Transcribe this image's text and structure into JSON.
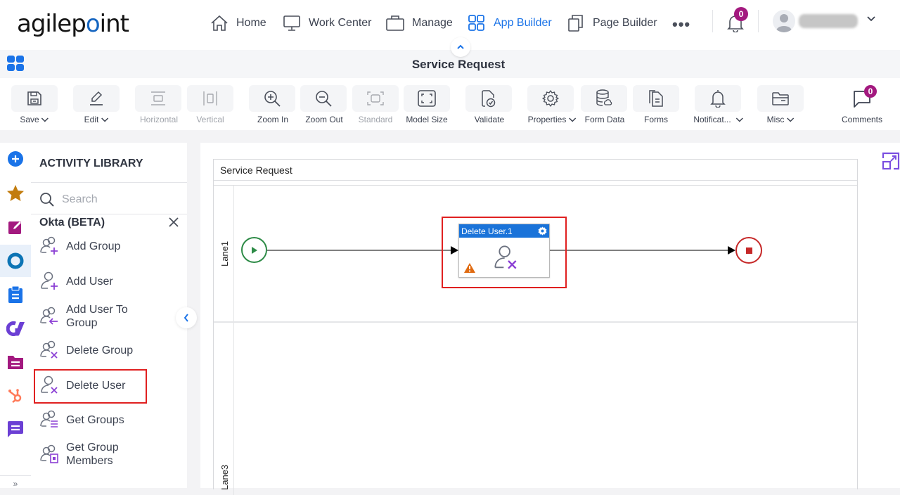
{
  "brand": {
    "logo_prefix": "agilep",
    "logo_dot": "o",
    "logo_suffix": "int",
    "accent": "#1a73e8",
    "badge_color": "#a3197f",
    "highlight_color": "#e02020"
  },
  "nav": {
    "items": [
      {
        "label": "Home",
        "icon": "home-icon",
        "active": false
      },
      {
        "label": "Work Center",
        "icon": "monitor-icon",
        "active": false
      },
      {
        "label": "Manage",
        "icon": "briefcase-icon",
        "active": false
      },
      {
        "label": "App Builder",
        "icon": "grid-icon",
        "active": true
      },
      {
        "label": "Page Builder",
        "icon": "pages-icon",
        "active": false
      }
    ],
    "more_label": "•••",
    "notifications_count": "0"
  },
  "page": {
    "title": "Service Request"
  },
  "toolbar": {
    "buttons": [
      {
        "label": "Save",
        "icon": "save-icon",
        "dropdown": true,
        "disabled": false
      },
      {
        "label": "Edit",
        "icon": "pencil-icon",
        "dropdown": true,
        "disabled": false
      },
      {
        "label": "Horizontal",
        "icon": "horizontal-layout-icon",
        "dropdown": false,
        "disabled": true
      },
      {
        "label": "Vertical",
        "icon": "vertical-layout-icon",
        "dropdown": false,
        "disabled": true
      },
      {
        "label": "Zoom In",
        "icon": "zoom-in-icon",
        "dropdown": false,
        "disabled": false
      },
      {
        "label": "Zoom Out",
        "icon": "zoom-out-icon",
        "dropdown": false,
        "disabled": false
      },
      {
        "label": "Standard",
        "icon": "standard-size-icon",
        "dropdown": false,
        "disabled": true
      },
      {
        "label": "Model Size",
        "icon": "model-size-icon",
        "dropdown": false,
        "disabled": false
      },
      {
        "label": "Validate",
        "icon": "validate-icon",
        "dropdown": false,
        "disabled": false
      },
      {
        "label": "Properties",
        "icon": "gear-icon",
        "dropdown": true,
        "disabled": false
      },
      {
        "label": "Form Data",
        "icon": "database-icon",
        "dropdown": false,
        "disabled": false
      },
      {
        "label": "Forms",
        "icon": "forms-icon",
        "dropdown": false,
        "disabled": false
      },
      {
        "label": "Notificat...",
        "icon": "bell-icon",
        "dropdown": true,
        "disabled": false
      },
      {
        "label": "Misc",
        "icon": "folder-icon",
        "dropdown": true,
        "disabled": false
      }
    ],
    "comments": {
      "label": "Comments",
      "count": "0"
    }
  },
  "rail": {
    "items": [
      {
        "name": "add-activity",
        "color": "#1a73e8"
      },
      {
        "name": "favorites",
        "color": "#c27c0e"
      },
      {
        "name": "eforms",
        "color": "#a3197f"
      },
      {
        "name": "okta",
        "color": "#0c74b5",
        "active": true
      },
      {
        "name": "tasks",
        "color": "#1a73e8"
      },
      {
        "name": "appian",
        "color": "#6b3fd4"
      },
      {
        "name": "documents",
        "color": "#a3197f"
      },
      {
        "name": "hubspot",
        "color": "#ff7a59"
      },
      {
        "name": "messaging",
        "color": "#6b3fd4"
      }
    ],
    "expand_label": "»"
  },
  "library": {
    "title": "ACTIVITY LIBRARY",
    "search_placeholder": "Search",
    "category": "Okta (BETA)",
    "activities": [
      {
        "line1": "Add Group",
        "line2": "",
        "badge": "plus"
      },
      {
        "line1": "Add User",
        "line2": "",
        "badge": "plus-single"
      },
      {
        "line1": "Add User To",
        "line2": "Group",
        "badge": "arrow"
      },
      {
        "line1": "Delete Group",
        "line2": "",
        "badge": "x"
      },
      {
        "line1": "Delete User",
        "line2": "",
        "badge": "x-single",
        "highlighted": true
      },
      {
        "line1": "Get Groups",
        "line2": "",
        "badge": "list"
      },
      {
        "line1": "Get Group",
        "line2": "Members",
        "badge": "card"
      }
    ]
  },
  "canvas": {
    "pool_name": "Service Request",
    "lanes": [
      "Lane1",
      "Lane3"
    ],
    "task": {
      "title": "Delete User.1",
      "warning": true,
      "highlighted": true
    }
  }
}
